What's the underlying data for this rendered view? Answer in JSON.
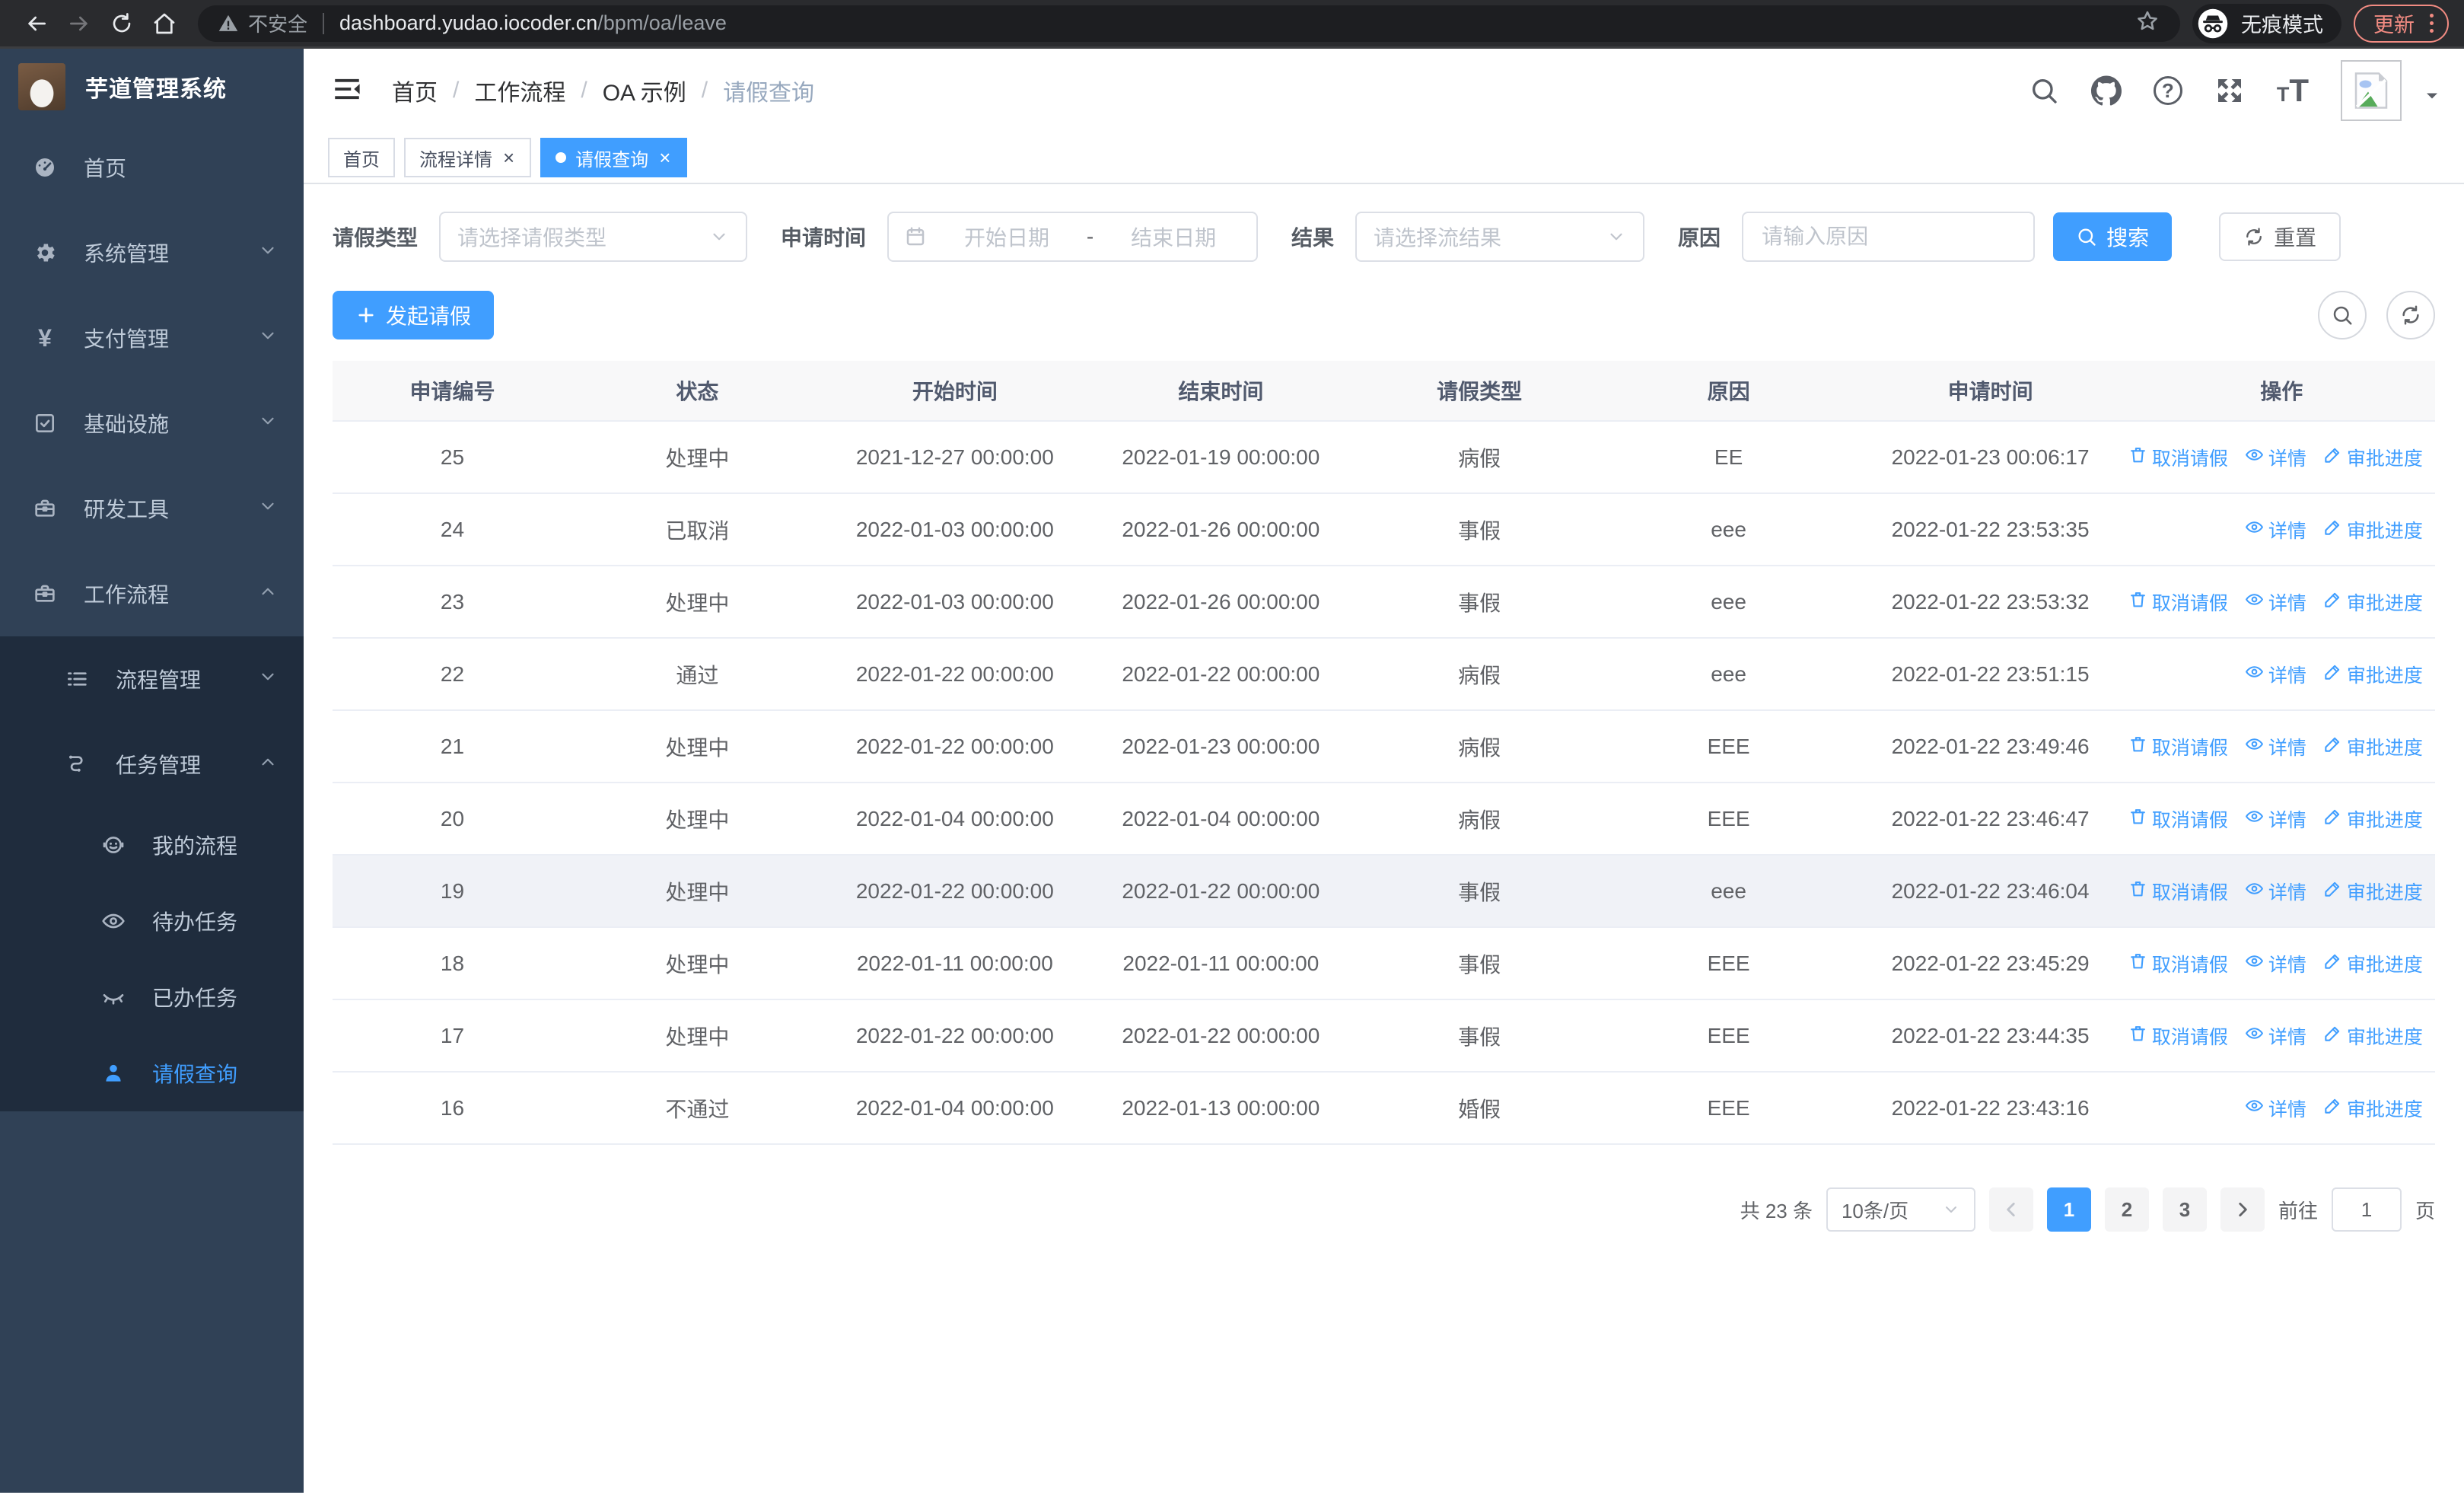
{
  "browser": {
    "security_label": "不安全",
    "url_host": "dashboard.yudao.iocoder.cn",
    "url_path": "/bpm/oa/leave",
    "incognito_label": "无痕模式",
    "update_label": "更新"
  },
  "sidebar": {
    "logo_title": "芋道管理系统",
    "items": [
      {
        "id": "home",
        "label": "首页",
        "icon": "dashboard-icon",
        "level": 1,
        "chevron": null,
        "submenu": false,
        "active": false
      },
      {
        "id": "system",
        "label": "系统管理",
        "icon": "gear-icon",
        "level": 1,
        "chevron": "down",
        "submenu": false,
        "active": false
      },
      {
        "id": "payment",
        "label": "支付管理",
        "icon": "yen-icon",
        "level": 1,
        "chevron": "down",
        "submenu": false,
        "active": false
      },
      {
        "id": "infrastructure",
        "label": "基础设施",
        "icon": "infra-icon",
        "level": 1,
        "chevron": "down",
        "submenu": false,
        "active": false
      },
      {
        "id": "dev-tools",
        "label": "研发工具",
        "icon": "toolbox-icon",
        "level": 1,
        "chevron": "down",
        "submenu": false,
        "active": false
      },
      {
        "id": "workflow",
        "label": "工作流程",
        "icon": "toolbox-icon",
        "level": 1,
        "chevron": "up",
        "submenu": false,
        "active": false
      },
      {
        "id": "process-mgmt",
        "label": "流程管理",
        "icon": "list-icon",
        "level": 2,
        "chevron": "down",
        "submenu": true,
        "active": false
      },
      {
        "id": "task-mgmt",
        "label": "任务管理",
        "icon": "flow-icon",
        "level": 2,
        "chevron": "up",
        "submenu": true,
        "active": false
      },
      {
        "id": "my-process",
        "label": "我的流程",
        "icon": "robot-icon",
        "level": 3,
        "chevron": null,
        "submenu": true,
        "active": false
      },
      {
        "id": "todo-tasks",
        "label": "待办任务",
        "icon": "eye-icon",
        "level": 3,
        "chevron": null,
        "submenu": true,
        "active": false
      },
      {
        "id": "done-tasks",
        "label": "已办任务",
        "icon": "eye-closed-icon",
        "level": 3,
        "chevron": null,
        "submenu": true,
        "active": false
      },
      {
        "id": "leave-query",
        "label": "请假查询",
        "icon": "user-icon",
        "level": 3,
        "chevron": null,
        "submenu": true,
        "active": true
      }
    ]
  },
  "navbar": {
    "breadcrumb": [
      "首页",
      "工作流程",
      "OA 示例",
      "请假查询"
    ],
    "breadcrumb_separator": "/",
    "icons": [
      {
        "id": "search",
        "icon": "search-icon"
      },
      {
        "id": "github",
        "icon": "github-icon"
      },
      {
        "id": "help",
        "icon": "question-icon"
      },
      {
        "id": "fullscreen",
        "icon": "fullscreen-icon"
      },
      {
        "id": "font-size",
        "icon": "font-size-icon"
      }
    ]
  },
  "tabs": [
    {
      "id": "home",
      "label": "首页",
      "closable": false,
      "active": false
    },
    {
      "id": "process-detail",
      "label": "流程详情",
      "closable": true,
      "active": false
    },
    {
      "id": "leave-query",
      "label": "请假查询",
      "closable": true,
      "active": true
    }
  ],
  "filters": {
    "leave_type": {
      "label": "请假类型",
      "placeholder": "请选择请假类型"
    },
    "apply_time": {
      "label": "申请时间",
      "start_placeholder": "开始日期",
      "separator": "-",
      "end_placeholder": "结束日期"
    },
    "result": {
      "label": "结果",
      "placeholder": "请选择流结果"
    },
    "reason": {
      "label": "原因",
      "placeholder": "请输入原因"
    },
    "search_label": "搜索",
    "reset_label": "重置"
  },
  "toolbar": {
    "create_label": "发起请假"
  },
  "table": {
    "columns": [
      "申请编号",
      "状态",
      "开始时间",
      "结束时间",
      "请假类型",
      "原因",
      "申请时间",
      "操作"
    ],
    "action_labels": {
      "cancel": "取消请假",
      "detail": "详情",
      "progress": "审批进度"
    },
    "rows": [
      {
        "id": "25",
        "status": "处理中",
        "start": "2021-12-27 00:00:00",
        "end": "2022-01-19 00:00:00",
        "type": "病假",
        "reason": "EE",
        "apply": "2022-01-23 00:06:17",
        "actions": [
          "cancel",
          "detail",
          "progress"
        ],
        "highlight": false
      },
      {
        "id": "24",
        "status": "已取消",
        "start": "2022-01-03 00:00:00",
        "end": "2022-01-26 00:00:00",
        "type": "事假",
        "reason": "eee",
        "apply": "2022-01-22 23:53:35",
        "actions": [
          "detail",
          "progress"
        ],
        "highlight": false
      },
      {
        "id": "23",
        "status": "处理中",
        "start": "2022-01-03 00:00:00",
        "end": "2022-01-26 00:00:00",
        "type": "事假",
        "reason": "eee",
        "apply": "2022-01-22 23:53:32",
        "actions": [
          "cancel",
          "detail",
          "progress"
        ],
        "highlight": false
      },
      {
        "id": "22",
        "status": "通过",
        "start": "2022-01-22 00:00:00",
        "end": "2022-01-22 00:00:00",
        "type": "病假",
        "reason": "eee",
        "apply": "2022-01-22 23:51:15",
        "actions": [
          "detail",
          "progress"
        ],
        "highlight": false
      },
      {
        "id": "21",
        "status": "处理中",
        "start": "2022-01-22 00:00:00",
        "end": "2022-01-23 00:00:00",
        "type": "病假",
        "reason": "EEE",
        "apply": "2022-01-22 23:49:46",
        "actions": [
          "cancel",
          "detail",
          "progress"
        ],
        "highlight": false
      },
      {
        "id": "20",
        "status": "处理中",
        "start": "2022-01-04 00:00:00",
        "end": "2022-01-04 00:00:00",
        "type": "病假",
        "reason": "EEE",
        "apply": "2022-01-22 23:46:47",
        "actions": [
          "cancel",
          "detail",
          "progress"
        ],
        "highlight": false
      },
      {
        "id": "19",
        "status": "处理中",
        "start": "2022-01-22 00:00:00",
        "end": "2022-01-22 00:00:00",
        "type": "事假",
        "reason": "eee",
        "apply": "2022-01-22 23:46:04",
        "actions": [
          "cancel",
          "detail",
          "progress"
        ],
        "highlight": true
      },
      {
        "id": "18",
        "status": "处理中",
        "start": "2022-01-11 00:00:00",
        "end": "2022-01-11 00:00:00",
        "type": "事假",
        "reason": "EEE",
        "apply": "2022-01-22 23:45:29",
        "actions": [
          "cancel",
          "detail",
          "progress"
        ],
        "highlight": false
      },
      {
        "id": "17",
        "status": "处理中",
        "start": "2022-01-22 00:00:00",
        "end": "2022-01-22 00:00:00",
        "type": "事假",
        "reason": "EEE",
        "apply": "2022-01-22 23:44:35",
        "actions": [
          "cancel",
          "detail",
          "progress"
        ],
        "highlight": false
      },
      {
        "id": "16",
        "status": "不通过",
        "start": "2022-01-04 00:00:00",
        "end": "2022-01-13 00:00:00",
        "type": "婚假",
        "reason": "EEE",
        "apply": "2022-01-22 23:43:16",
        "actions": [
          "detail",
          "progress"
        ],
        "highlight": false
      }
    ]
  },
  "pagination": {
    "total_label": "共 23 条",
    "page_size_label": "10条/页",
    "pages": [
      "1",
      "2",
      "3"
    ],
    "active_page": "1",
    "goto_label": "前往",
    "goto_value": "1",
    "page_unit": "页"
  },
  "colors": {
    "primary": "#409eff",
    "sidebar_bg": "#304156",
    "submenu_bg": "#1f2c3d",
    "update_accent": "#f28b82"
  }
}
